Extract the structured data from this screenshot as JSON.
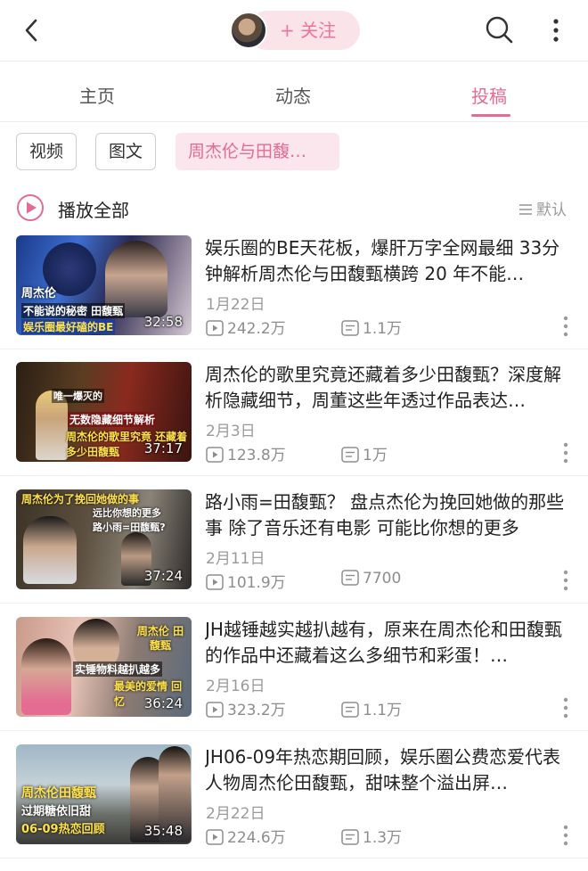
{
  "header": {
    "follow_label": "+ 关注",
    "back_icon": "back-chevron-icon",
    "search_icon": "search-icon",
    "more_icon": "more-vertical-icon"
  },
  "tabs": [
    {
      "label": "主页",
      "active": false
    },
    {
      "label": "动态",
      "active": false
    },
    {
      "label": "投稿",
      "active": true
    }
  ],
  "chips": [
    {
      "label": "视频",
      "active": false
    },
    {
      "label": "图文",
      "active": false
    },
    {
      "label": "周杰伦与田馥…",
      "active": true
    }
  ],
  "play_all": {
    "label": "播放全部"
  },
  "sort": {
    "label": "默认"
  },
  "colors": {
    "accent": "#e46b93",
    "accent_bg": "#fbe6ee",
    "muted": "#9a9a9a"
  },
  "videos": [
    {
      "title": "娱乐圈的BE天花板，爆肝万字全网最细 33分钟解析周杰伦与田馥甄横跨 20 年不能…",
      "date": "1月22日",
      "views": "242.2万",
      "comments": "1.1万",
      "duration": "32:58",
      "thumb_caption_top": "周杰伦",
      "thumb_caption_bottom": "不能说的秘密 田馥甄",
      "thumb_caption_extra": "娱乐圈最好磕的BE"
    },
    {
      "title": "周杰伦的歌里究竟还藏着多少田馥甄？深度解析隐藏细节，周董这些年透过作品表达…",
      "date": "2月3日",
      "views": "123.8万",
      "comments": "1万",
      "duration": "37:17",
      "thumb_caption_top": "唯一爆灭的",
      "thumb_caption_bottom": "无数隐藏细节解析",
      "thumb_caption_extra": "周杰伦的歌里究竟 还藏着多少田馥甄"
    },
    {
      "title": "路小雨=田馥甄？ 盘点杰伦为挽回她做的那些事 除了音乐还有电影 可能比你想的更多",
      "date": "2月11日",
      "views": "101.9万",
      "comments": "7700",
      "duration": "37:24",
      "thumb_caption_top": "周杰伦为了挽回她做的事",
      "thumb_caption_bottom": "远比你想的更多",
      "thumb_caption_extra": "路小雨=田馥甄?"
    },
    {
      "title": "JH越锤越实越扒越有，原来在周杰伦和田馥甄的作品中还藏着这么多细节和彩蛋！…",
      "date": "2月16日",
      "views": "323.2万",
      "comments": "1.1万",
      "duration": "36:24",
      "thumb_caption_top": "周杰伦 田馥甄",
      "thumb_caption_bottom": "实锤物料越扒越多",
      "thumb_caption_extra": "最美的爱情 回忆"
    },
    {
      "title": "JH06-09年热恋期回顾，娱乐圈公费恋爱代表人物周杰伦田馥甄，甜味整个溢出屏…",
      "date": "2月22日",
      "views": "224.6万",
      "comments": "1.3万",
      "duration": "35:48",
      "thumb_caption_top": "周杰伦田馥甄",
      "thumb_caption_bottom": "过期糖依旧甜",
      "thumb_caption_extra": "06-09热恋回顾"
    }
  ]
}
